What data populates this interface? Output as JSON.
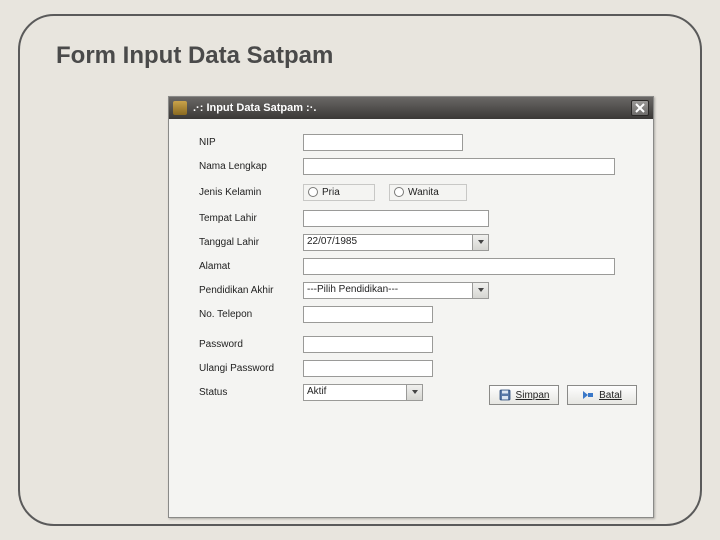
{
  "slide": {
    "title": "Form Input Data Satpam"
  },
  "window": {
    "title": ".·: Input Data Satpam :·."
  },
  "labels": {
    "nip": "NIP",
    "nama": "Nama Lengkap",
    "jenis": "Jenis Kelamin",
    "tempat": "Tempat Lahir",
    "tanggal": "Tanggal Lahir",
    "alamat": "Alamat",
    "pendidikan": "Pendidikan Akhir",
    "telepon": "No. Telepon",
    "password": "Password",
    "ulangi": "Ulangi Password",
    "status": "Status"
  },
  "values": {
    "nip": "",
    "nama": "",
    "tempat": "",
    "tanggal": "22/07/1985",
    "alamat": "",
    "pendidikan": "---Pilih Pendidikan---",
    "telepon": "",
    "password": "",
    "ulangi": "",
    "status": "Aktif"
  },
  "gender": {
    "pria": "Pria",
    "wanita": "Wanita"
  },
  "buttons": {
    "simpan": "Simpan",
    "batal": "Batal"
  }
}
